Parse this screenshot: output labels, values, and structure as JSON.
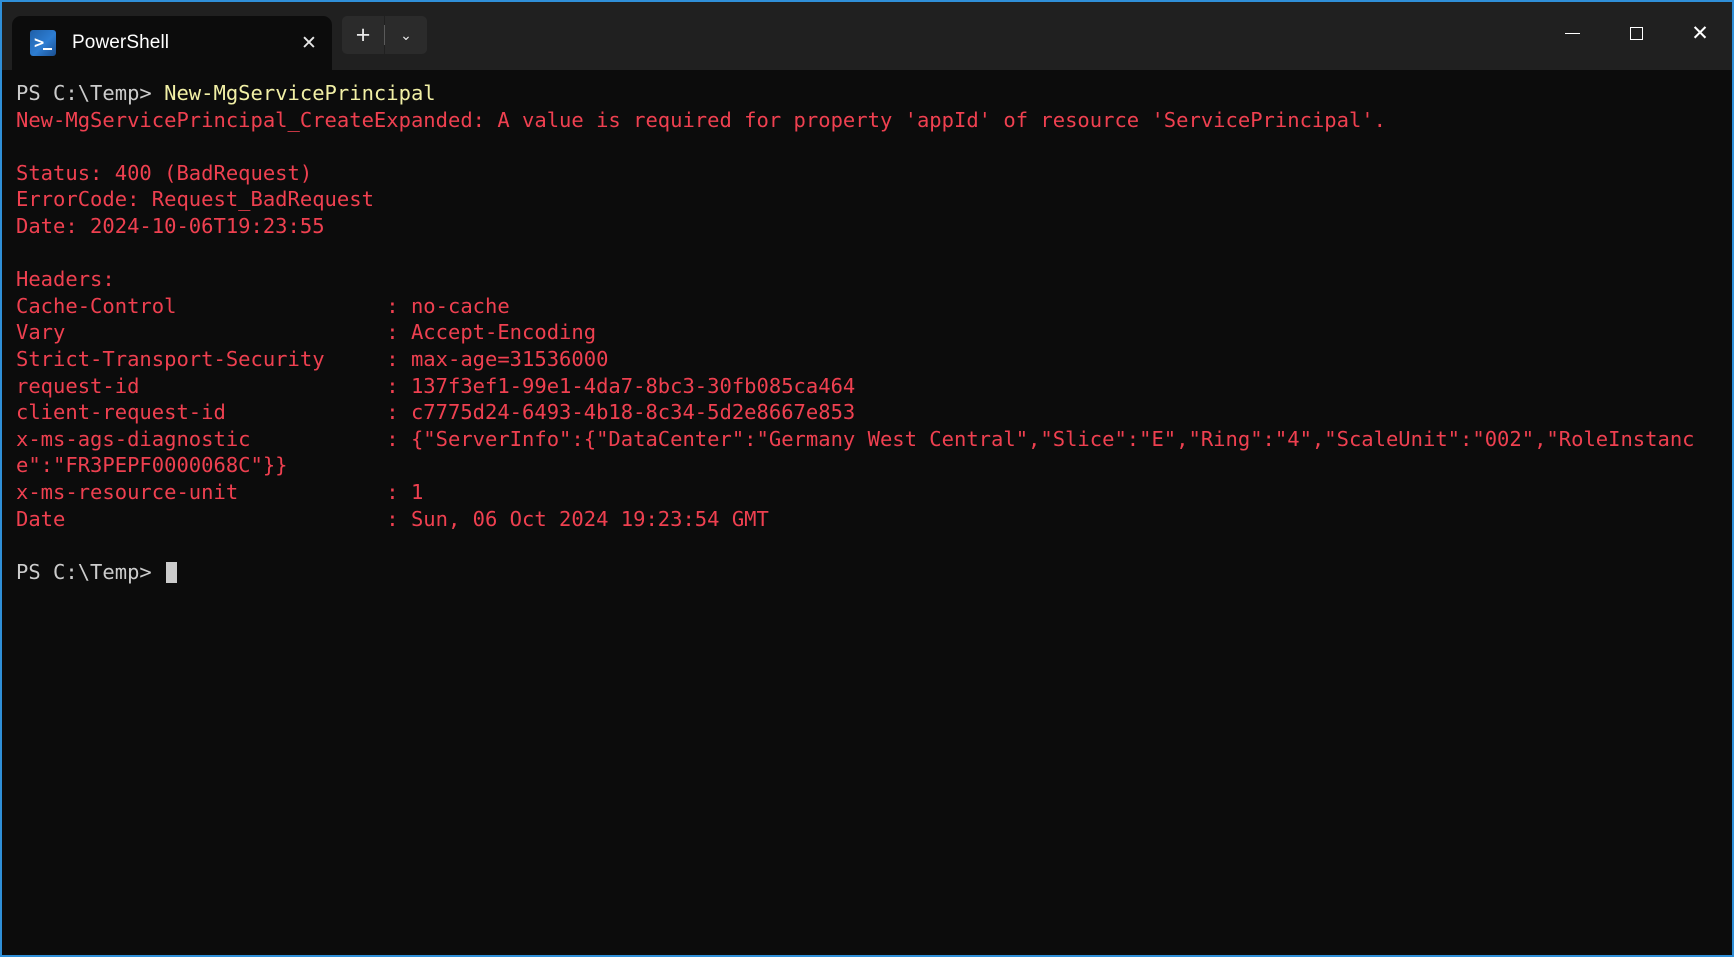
{
  "window": {
    "accent_border_color": "#2f8fd8",
    "titlebar_bg": "#202020",
    "console_bg": "#0c0c0c"
  },
  "titlebar": {
    "tab": {
      "title": "PowerShell",
      "icon": "powershell-icon",
      "close_label": "✕"
    },
    "new_tab_label": "+",
    "dropdown_label": "⌄",
    "caption": {
      "minimize_label": "",
      "maximize_label": "",
      "close_label": "✕"
    }
  },
  "console": {
    "colors": {
      "prompt": "#cccccc",
      "command": "#f2f0a6",
      "error": "#ef4050"
    },
    "lines": [
      {
        "type": "command-line",
        "prompt": "PS C:\\Temp> ",
        "command": "New-MgServicePrincipal"
      },
      {
        "type": "error",
        "text": "New-MgServicePrincipal_CreateExpanded: A value is required for property 'appId' of resource 'ServicePrincipal'."
      },
      {
        "type": "blank",
        "text": ""
      },
      {
        "type": "error",
        "text": "Status: 400 (BadRequest)"
      },
      {
        "type": "error",
        "text": "ErrorCode: Request_BadRequest"
      },
      {
        "type": "error",
        "text": "Date: 2024-10-06T19:23:55"
      },
      {
        "type": "blank",
        "text": ""
      },
      {
        "type": "error",
        "text": "Headers:"
      },
      {
        "type": "error",
        "text": "Cache-Control                 : no-cache"
      },
      {
        "type": "error",
        "text": "Vary                          : Accept-Encoding"
      },
      {
        "type": "error",
        "text": "Strict-Transport-Security     : max-age=31536000"
      },
      {
        "type": "error",
        "text": "request-id                    : 137f3ef1-99e1-4da7-8bc3-30fb085ca464"
      },
      {
        "type": "error",
        "text": "client-request-id             : c7775d24-6493-4b18-8c34-5d2e8667e853"
      },
      {
        "type": "error",
        "text": "x-ms-ags-diagnostic           : {\"ServerInfo\":{\"DataCenter\":\"Germany West Central\",\"Slice\":\"E\",\"Ring\":\"4\",\"ScaleUnit\":\"002\",\"RoleInstance\":\"FR3PEPF0000068C\"}}"
      },
      {
        "type": "error",
        "text": "x-ms-resource-unit            : 1"
      },
      {
        "type": "error",
        "text": "Date                          : Sun, 06 Oct 2024 19:23:54 GMT"
      },
      {
        "type": "blank",
        "text": ""
      },
      {
        "type": "prompt-line",
        "prompt": "PS C:\\Temp> ",
        "command": ""
      }
    ]
  }
}
